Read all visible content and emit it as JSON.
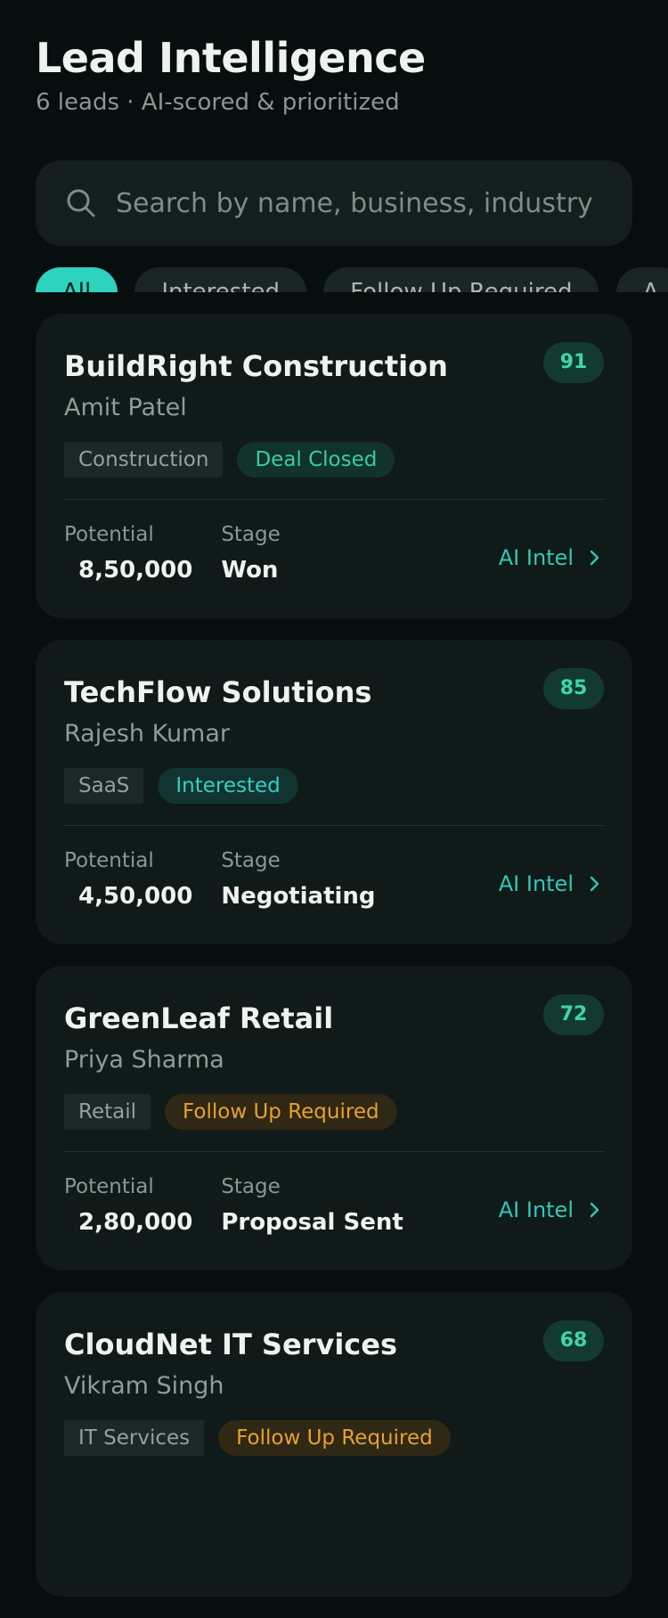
{
  "header": {
    "title": "Lead Intelligence",
    "subtitle": "6 leads · AI-scored & prioritized"
  },
  "search": {
    "placeholder": "Search by name, business, industry",
    "icon": "search-icon"
  },
  "filters": [
    {
      "label": "All",
      "active": true
    },
    {
      "label": "Interested",
      "active": false
    },
    {
      "label": "Follow Up Required",
      "active": false
    },
    {
      "label": "A",
      "active": false
    }
  ],
  "labels": {
    "potential": "Potential",
    "stage": "Stage",
    "ai_intel": "AI Intel"
  },
  "colors": {
    "accent": "#2ed3bf",
    "card_bg": "#101a19",
    "status_closed": "#38cf98",
    "status_interested": "#34d1c0",
    "status_follow": "#e7a12f"
  },
  "leads": [
    {
      "company": "BuildRight Construction",
      "contact": "Amit Patel",
      "score": "91",
      "industry": "Construction",
      "status": "Deal Closed",
      "potential": "8,50,000",
      "stage": "Won"
    },
    {
      "company": "TechFlow Solutions",
      "contact": "Rajesh Kumar",
      "score": "85",
      "industry": "SaaS",
      "status": "Interested",
      "potential": "4,50,000",
      "stage": "Negotiating"
    },
    {
      "company": "GreenLeaf Retail",
      "contact": "Priya Sharma",
      "score": "72",
      "industry": "Retail",
      "status": "Follow Up Required",
      "potential": "2,80,000",
      "stage": "Proposal Sent"
    },
    {
      "company": "CloudNet IT Services",
      "contact": "Vikram Singh",
      "score": "68",
      "industry": "IT Services",
      "status": "Follow Up Required"
    }
  ]
}
